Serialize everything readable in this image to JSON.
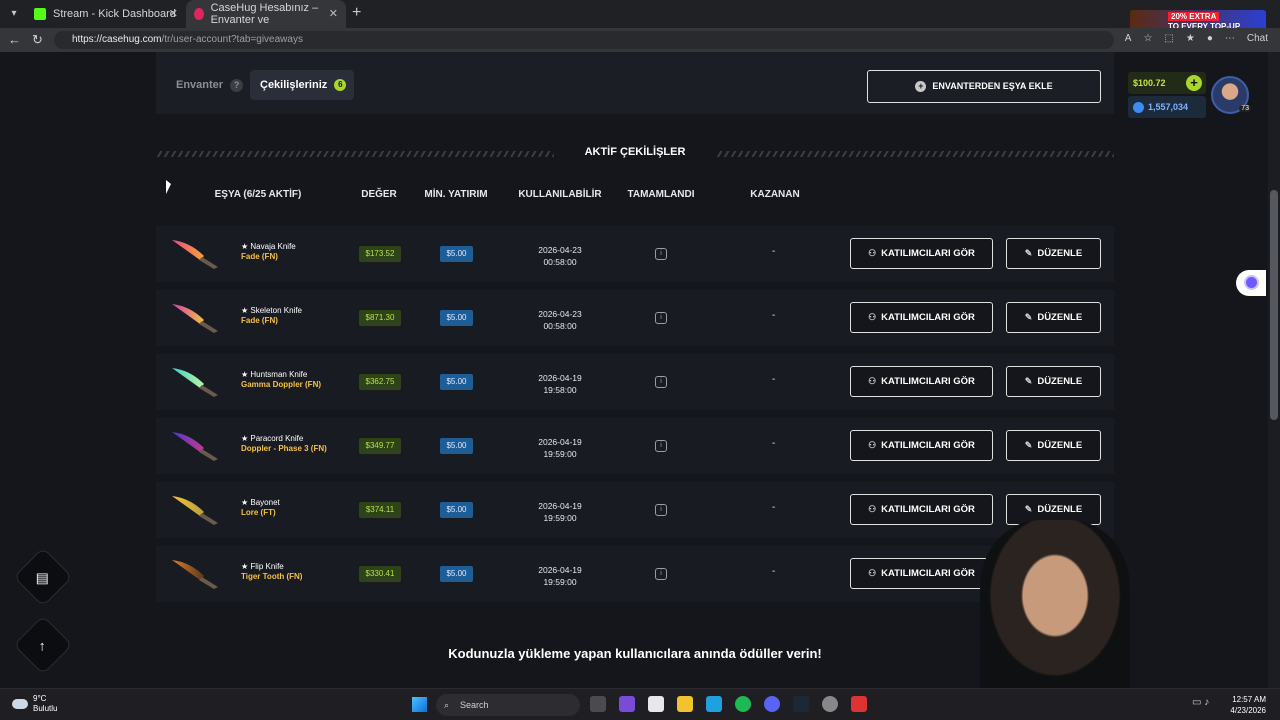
{
  "browser": {
    "tabs": [
      {
        "title": "Stream - Kick Dashboard",
        "favicon_color": "#53fc18"
      },
      {
        "title": "CaseHug Hesabınız – Envanter ve",
        "favicon_color": "#e0245e"
      }
    ],
    "url_host": "https://casehug.com",
    "url_path": "/tr/user-account?tab=giveaways",
    "ad_line1": "20% EXTRA",
    "ad_line2": "TO EVERY TOP-UP",
    "chat_label": "Chat"
  },
  "tabs": {
    "inventory": "Envanter",
    "inventory_help": "?",
    "giveaways": "Çekilişleriniz",
    "giveaways_count": "6"
  },
  "add_button": "ENVANTERDEN EŞYA EKLE",
  "wallet": {
    "balance": "$100.72",
    "points": "1,557,034",
    "level": "73"
  },
  "section_title": "AKTİF ÇEKİLİŞLER",
  "columns": {
    "item": "EŞYA (6/25 AKTİF)",
    "value": "DEĞER",
    "min_deposit": "MİN. YATIRIM",
    "available": "KULLANILABİLİR",
    "completed": "TAMAMLANDI",
    "winner": "KAZANAN"
  },
  "rows": [
    {
      "name": "★ Navaja Knife",
      "finish": "Fade (FN)",
      "value": "$173.52",
      "min": "$5.00",
      "date": "2026-04-23",
      "time": "00:58:00",
      "winner": "-",
      "participants": "KATILIMCILARI GÖR",
      "edit": "DÜZENLE"
    },
    {
      "name": "★ Skeleton Knife",
      "finish": "Fade (FN)",
      "value": "$871.30",
      "min": "$5.00",
      "date": "2026-04-23",
      "time": "00:58:00",
      "winner": "-",
      "participants": "KATILIMCILARI GÖR",
      "edit": "DÜZENLE"
    },
    {
      "name": "★ Huntsman Knife",
      "finish": "Gamma Doppler (FN)",
      "value": "$362.75",
      "min": "$5.00",
      "date": "2026-04-19",
      "time": "19:58:00",
      "winner": "-",
      "participants": "KATILIMCILARI GÖR",
      "edit": "DÜZENLE"
    },
    {
      "name": "★ Paracord Knife",
      "finish": "Doppler - Phase 3 (FN)",
      "value": "$349.77",
      "min": "$5.00",
      "date": "2026-04-19",
      "time": "19:59:00",
      "winner": "-",
      "participants": "KATILIMCILARI GÖR",
      "edit": "DÜZENLE"
    },
    {
      "name": "★ Bayonet",
      "finish": "Lore (FT)",
      "value": "$374.11",
      "min": "$5.00",
      "date": "2026-04-19",
      "time": "19:59:00",
      "winner": "-",
      "participants": "KATILIMCILARI GÖR",
      "edit": "DÜZENLE"
    },
    {
      "name": "★ Flip Knife",
      "finish": "Tiger Tooth (FN)",
      "value": "$330.41",
      "min": "$5.00",
      "date": "2026-04-19",
      "time": "19:59:00",
      "winner": "-",
      "participants": "KATILIMCILARI GÖR",
      "edit": ""
    }
  ],
  "bottom_text": "Kodunuzla yükleme yapan kullanıcılara anında ödüller verin!",
  "taskbar": {
    "temp": "9°C",
    "weather": "Bulutlu",
    "search": "Search",
    "time": "12:57 AM",
    "date": "4/23/2026"
  },
  "icons": [
    "chat-icon",
    "arrow-up-icon",
    "users-icon",
    "pencil-icon",
    "plus-icon",
    "info-icon"
  ]
}
